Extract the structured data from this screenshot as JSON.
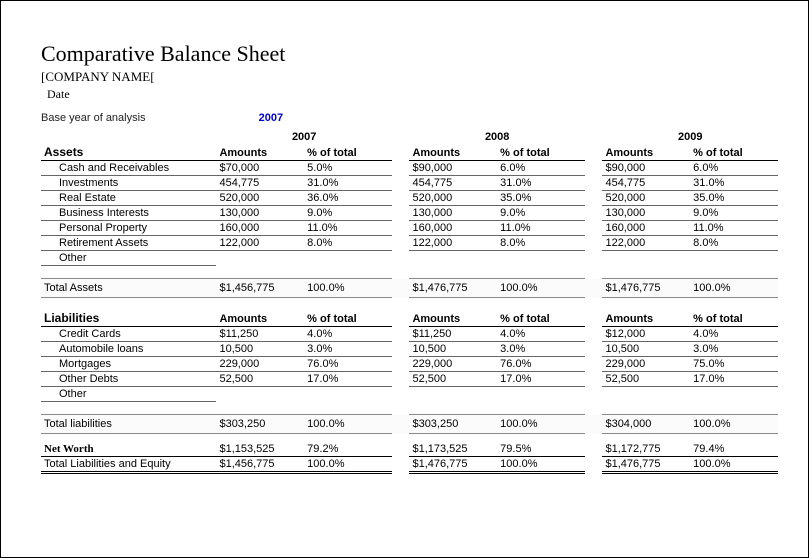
{
  "title": "Comparative Balance Sheet",
  "company": "[COMPANY NAME[",
  "date_label": "Date",
  "base_year_label": "Base year of analysis",
  "base_year_value": "2007",
  "years": [
    "2007",
    "2008",
    "2009"
  ],
  "col_amounts": "Amounts",
  "col_pct": "% of total",
  "assets": {
    "header": "Assets",
    "rows": [
      {
        "label": "Cash and Receivables",
        "y1a": "$70,000",
        "y1p": "5.0%",
        "y2a": "$90,000",
        "y2p": "6.0%",
        "y3a": "$90,000",
        "y3p": "6.0%"
      },
      {
        "label": "Investments",
        "y1a": "454,775",
        "y1p": "31.0%",
        "y2a": "454,775",
        "y2p": "31.0%",
        "y3a": "454,775",
        "y3p": "31.0%"
      },
      {
        "label": "Real Estate",
        "y1a": "520,000",
        "y1p": "36.0%",
        "y2a": "520,000",
        "y2p": "35.0%",
        "y3a": "520,000",
        "y3p": "35.0%"
      },
      {
        "label": "Business Interests",
        "y1a": "130,000",
        "y1p": "9.0%",
        "y2a": "130,000",
        "y2p": "9.0%",
        "y3a": "130,000",
        "y3p": "9.0%"
      },
      {
        "label": "Personal Property",
        "y1a": "160,000",
        "y1p": "11.0%",
        "y2a": "160,000",
        "y2p": "11.0%",
        "y3a": "160,000",
        "y3p": "11.0%"
      },
      {
        "label": "Retirement Assets",
        "y1a": "122,000",
        "y1p": "8.0%",
        "y2a": "122,000",
        "y2p": "8.0%",
        "y3a": "122,000",
        "y3p": "8.0%"
      },
      {
        "label": "Other",
        "y1a": "",
        "y1p": "",
        "y2a": "",
        "y2p": "",
        "y3a": "",
        "y3p": ""
      }
    ],
    "total_label": "Total Assets",
    "total": {
      "y1a": "$1,456,775",
      "y1p": "100.0%",
      "y2a": "$1,476,775",
      "y2p": "100.0%",
      "y3a": "$1,476,775",
      "y3p": "100.0%"
    }
  },
  "liabilities": {
    "header": "Liabilities",
    "rows": [
      {
        "label": "Credit Cards",
        "y1a": "$11,250",
        "y1p": "4.0%",
        "y2a": "$11,250",
        "y2p": "4.0%",
        "y3a": "$12,000",
        "y3p": "4.0%"
      },
      {
        "label": "Automobile loans",
        "y1a": "10,500",
        "y1p": "3.0%",
        "y2a": "10,500",
        "y2p": "3.0%",
        "y3a": "10,500",
        "y3p": "3.0%"
      },
      {
        "label": "Mortgages",
        "y1a": "229,000",
        "y1p": "76.0%",
        "y2a": "229,000",
        "y2p": "76.0%",
        "y3a": "229,000",
        "y3p": "75.0%"
      },
      {
        "label": "Other Debts",
        "y1a": "52,500",
        "y1p": "17.0%",
        "y2a": "52,500",
        "y2p": "17.0%",
        "y3a": "52,500",
        "y3p": "17.0%"
      },
      {
        "label": "Other",
        "y1a": "",
        "y1p": "",
        "y2a": "",
        "y2p": "",
        "y3a": "",
        "y3p": ""
      }
    ],
    "total_label": "Total liabilities",
    "total": {
      "y1a": "$303,250",
      "y1p": "100.0%",
      "y2a": "$303,250",
      "y2p": "100.0%",
      "y3a": "$304,000",
      "y3p": "100.0%"
    }
  },
  "networth": {
    "label": "Net Worth",
    "values": {
      "y1a": "$1,153,525",
      "y1p": "79.2%",
      "y2a": "$1,173,525",
      "y2p": "79.5%",
      "y3a": "$1,172,775",
      "y3p": "79.4%"
    }
  },
  "tle": {
    "label": "Total Liabilities and Equity",
    "values": {
      "y1a": "$1,456,775",
      "y1p": "100.0%",
      "y2a": "$1,476,775",
      "y2p": "100.0%",
      "y3a": "$1,476,775",
      "y3p": "100.0%"
    }
  }
}
